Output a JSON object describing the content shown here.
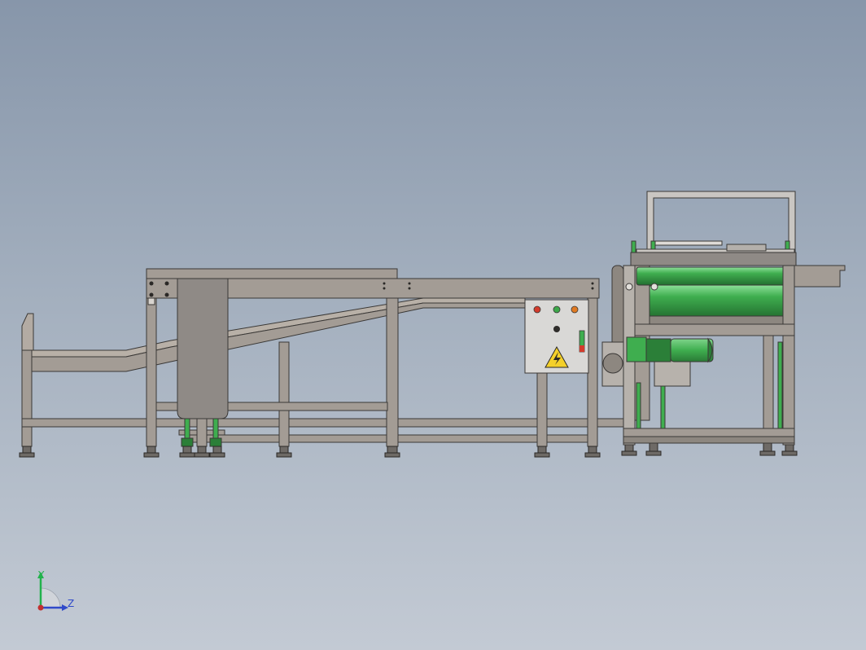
{
  "scene": {
    "background_top": "#8796aa",
    "background_bottom": "#c3cad4"
  },
  "colors": {
    "frame": "#a39c95",
    "frame_dark": "#8d8780",
    "outline": "#3a3836",
    "plate": "#8f8a86",
    "inclined_belt": "#b0a89f",
    "control_box": "#d9d8d6",
    "motor_green": "#3fae4f",
    "motor_green_dark": "#2b7f38",
    "rail": "#c9c6c2",
    "button_red": "#d33b2c",
    "button_green": "#3da84a",
    "button_orange": "#e07a22",
    "warning_yellow": "#f4d02a"
  },
  "control_box": {
    "icons": [
      "red-button-icon",
      "green-button-icon",
      "orange-button-icon",
      "selector-switch-icon",
      "high-voltage-warning-icon"
    ]
  },
  "triad": {
    "y_label": "Y",
    "z_label": "Z",
    "y_color": "#22b24c",
    "z_color": "#2f49c9",
    "origin_color": "#c23030"
  }
}
